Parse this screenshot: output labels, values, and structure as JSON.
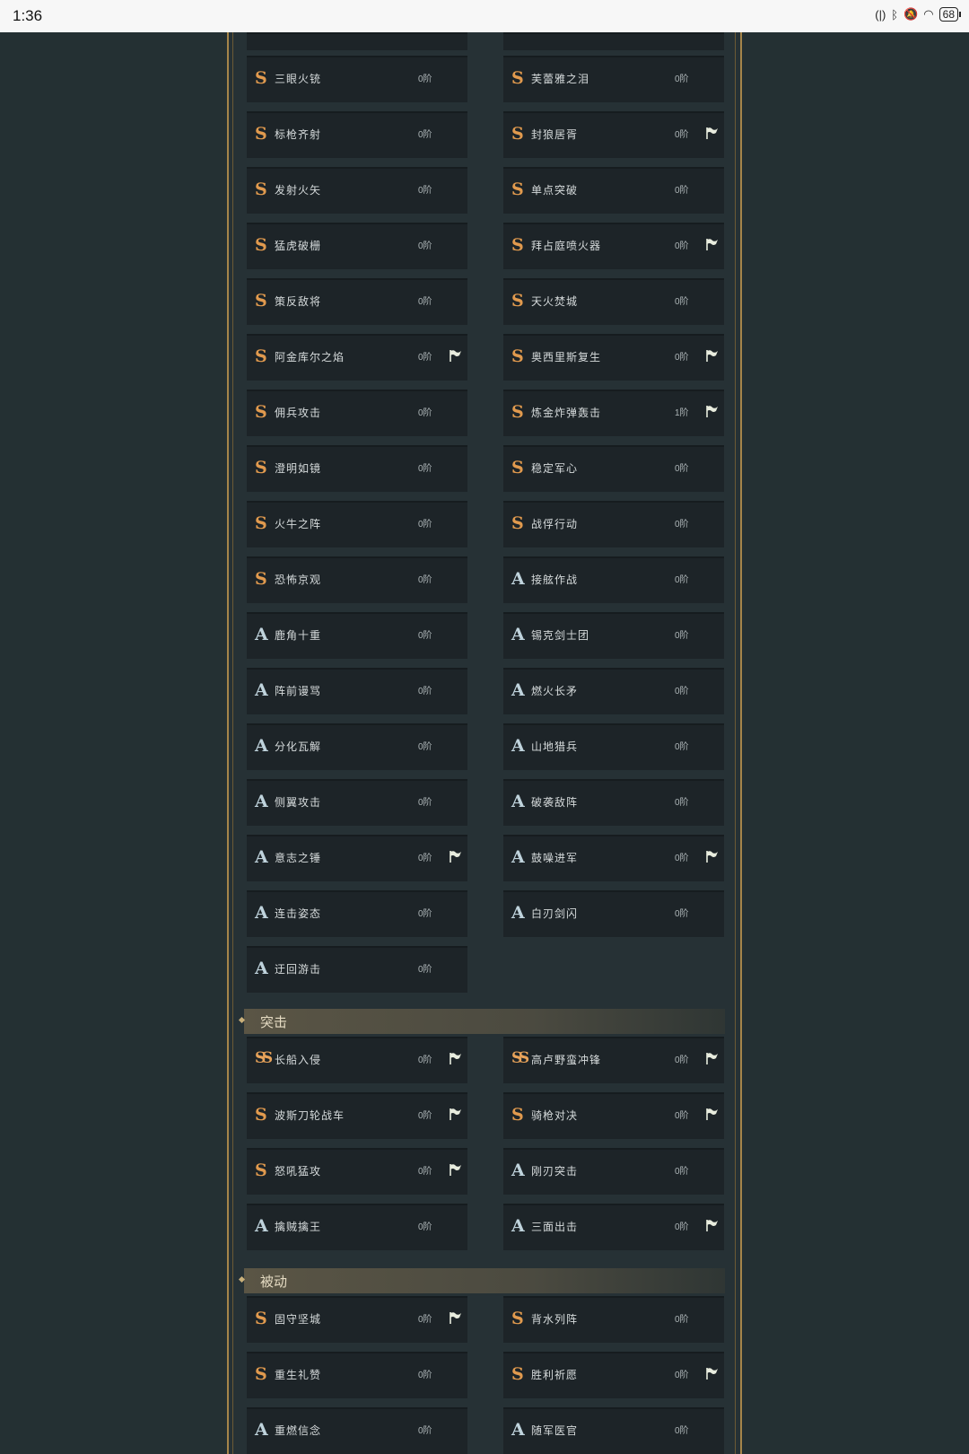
{
  "status_bar": {
    "time": "1:36",
    "battery": "68"
  },
  "sections": [
    {
      "title": "突击"
    },
    {
      "title": "被动"
    }
  ],
  "skills": [
    {
      "grade": "S",
      "name": "三眼火铳",
      "tier": "0阶",
      "flag": false
    },
    {
      "grade": "S",
      "name": "芙蕾雅之泪",
      "tier": "0阶",
      "flag": false
    },
    {
      "grade": "S",
      "name": "标枪齐射",
      "tier": "0阶",
      "flag": false
    },
    {
      "grade": "S",
      "name": "封狼居胥",
      "tier": "0阶",
      "flag": true
    },
    {
      "grade": "S",
      "name": "发射火矢",
      "tier": "0阶",
      "flag": false
    },
    {
      "grade": "S",
      "name": "单点突破",
      "tier": "0阶",
      "flag": false
    },
    {
      "grade": "S",
      "name": "猛虎破栅",
      "tier": "0阶",
      "flag": false
    },
    {
      "grade": "S",
      "name": "拜占庭喷火器",
      "tier": "0阶",
      "flag": true
    },
    {
      "grade": "S",
      "name": "策反敌将",
      "tier": "0阶",
      "flag": false
    },
    {
      "grade": "S",
      "name": "天火焚城",
      "tier": "0阶",
      "flag": false
    },
    {
      "grade": "S",
      "name": "阿金库尔之焰",
      "tier": "0阶",
      "flag": true
    },
    {
      "grade": "S",
      "name": "奥西里斯复生",
      "tier": "0阶",
      "flag": true
    },
    {
      "grade": "S",
      "name": "佣兵攻击",
      "tier": "0阶",
      "flag": false
    },
    {
      "grade": "S",
      "name": "炼金炸弹轰击",
      "tier": "1阶",
      "flag": true
    },
    {
      "grade": "S",
      "name": "澄明如镜",
      "tier": "0阶",
      "flag": false
    },
    {
      "grade": "S",
      "name": "稳定军心",
      "tier": "0阶",
      "flag": false
    },
    {
      "grade": "S",
      "name": "火牛之阵",
      "tier": "0阶",
      "flag": false
    },
    {
      "grade": "S",
      "name": "战俘行动",
      "tier": "0阶",
      "flag": false
    },
    {
      "grade": "S",
      "name": "恐怖京观",
      "tier": "0阶",
      "flag": false
    },
    {
      "grade": "A",
      "name": "接舷作战",
      "tier": "0阶",
      "flag": false
    },
    {
      "grade": "A",
      "name": "鹿角十重",
      "tier": "0阶",
      "flag": false
    },
    {
      "grade": "A",
      "name": "锡克剑士团",
      "tier": "0阶",
      "flag": false
    },
    {
      "grade": "A",
      "name": "阵前谩骂",
      "tier": "0阶",
      "flag": false
    },
    {
      "grade": "A",
      "name": "燃火长矛",
      "tier": "0阶",
      "flag": false
    },
    {
      "grade": "A",
      "name": "分化瓦解",
      "tier": "0阶",
      "flag": false
    },
    {
      "grade": "A",
      "name": "山地猎兵",
      "tier": "0阶",
      "flag": false
    },
    {
      "grade": "A",
      "name": "侧翼攻击",
      "tier": "0阶",
      "flag": false
    },
    {
      "grade": "A",
      "name": "破袭敌阵",
      "tier": "0阶",
      "flag": false
    },
    {
      "grade": "A",
      "name": "意志之锤",
      "tier": "0阶",
      "flag": true
    },
    {
      "grade": "A",
      "name": "鼓噪进军",
      "tier": "0阶",
      "flag": true
    },
    {
      "grade": "A",
      "name": "连击姿态",
      "tier": "0阶",
      "flag": false
    },
    {
      "grade": "A",
      "name": "白刃剑闪",
      "tier": "0阶",
      "flag": false
    },
    {
      "grade": "A",
      "name": "迂回游击",
      "tier": "0阶",
      "flag": false
    },
    {
      "grade": "SS",
      "name": "长船入侵",
      "tier": "0阶",
      "flag": true
    },
    {
      "grade": "SS",
      "name": "高卢野蛮冲锋",
      "tier": "0阶",
      "flag": true
    },
    {
      "grade": "S",
      "name": "波斯刀轮战车",
      "tier": "0阶",
      "flag": true
    },
    {
      "grade": "S",
      "name": "骑枪对决",
      "tier": "0阶",
      "flag": true
    },
    {
      "grade": "S",
      "name": "怒吼猛攻",
      "tier": "0阶",
      "flag": true
    },
    {
      "grade": "A",
      "name": "刚刃突击",
      "tier": "0阶",
      "flag": false
    },
    {
      "grade": "A",
      "name": "擒贼擒王",
      "tier": "0阶",
      "flag": false
    },
    {
      "grade": "A",
      "name": "三面出击",
      "tier": "0阶",
      "flag": true
    },
    {
      "grade": "S",
      "name": "固守坚城",
      "tier": "0阶",
      "flag": true
    },
    {
      "grade": "S",
      "name": "背水列阵",
      "tier": "0阶",
      "flag": false
    },
    {
      "grade": "S",
      "name": "重生礼赞",
      "tier": "0阶",
      "flag": false
    },
    {
      "grade": "S",
      "name": "胜利祈愿",
      "tier": "0阶",
      "flag": true
    },
    {
      "grade": "A",
      "name": "重燃信念",
      "tier": "0阶",
      "flag": false
    },
    {
      "grade": "A",
      "name": "随军医官",
      "tier": "0阶",
      "flag": false
    }
  ]
}
